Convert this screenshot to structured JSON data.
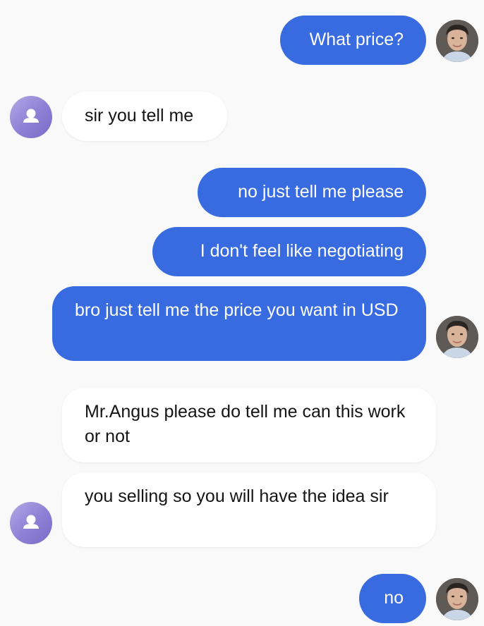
{
  "conversation": {
    "messages": [
      {
        "from": "me",
        "text": "What price?"
      },
      {
        "from": "them",
        "text": "sir you tell me"
      },
      {
        "from": "me",
        "text": "no just tell me please"
      },
      {
        "from": "me",
        "text": "I don't feel like negotiating"
      },
      {
        "from": "me",
        "text": "bro just tell me the price you want in USD"
      },
      {
        "from": "them",
        "text": "Mr.Angus please do tell me can this work or not"
      },
      {
        "from": "them",
        "text": "you selling so you will have the idea sir"
      },
      {
        "from": "me",
        "text": "no"
      }
    ]
  },
  "colors": {
    "outgoing_bubble": "#376bdf",
    "incoming_bubble": "#ffffff",
    "background": "#f9f9f9",
    "placeholder_avatar": "#8c7fd4"
  },
  "icons": {
    "contact_avatar": "user-placeholder-icon",
    "my_avatar": "profile-photo"
  }
}
